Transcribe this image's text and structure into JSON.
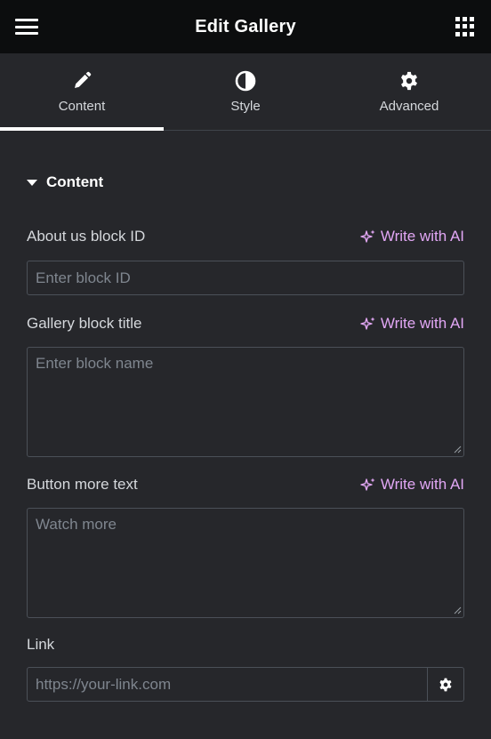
{
  "header": {
    "title": "Edit Gallery",
    "menu_icon": "hamburger-icon",
    "apps_icon": "grid-icon"
  },
  "tabs": [
    {
      "label": "Content",
      "icon": "pencil-icon",
      "active": true
    },
    {
      "label": "Style",
      "icon": "half-circle-icon",
      "active": false
    },
    {
      "label": "Advanced",
      "icon": "gear-icon",
      "active": false
    }
  ],
  "section": {
    "title": "Content",
    "expanded": true
  },
  "fields": [
    {
      "label": "About us block ID",
      "ai": "Write with AI",
      "placeholder": "Enter block ID",
      "value": ""
    },
    {
      "label": "Gallery block title",
      "ai": "Write with AI",
      "placeholder": "Enter block name",
      "value": ""
    },
    {
      "label": "Button more text",
      "ai": "Write with AI",
      "placeholder": "Watch more",
      "value": ""
    },
    {
      "label": "Link",
      "placeholder": "https://your-link.com",
      "value": ""
    }
  ],
  "colors": {
    "accent_ai": "#e2a7f5",
    "header_bg": "#0c0d0e",
    "panel_bg": "#26272b",
    "border": "#4b5058"
  }
}
